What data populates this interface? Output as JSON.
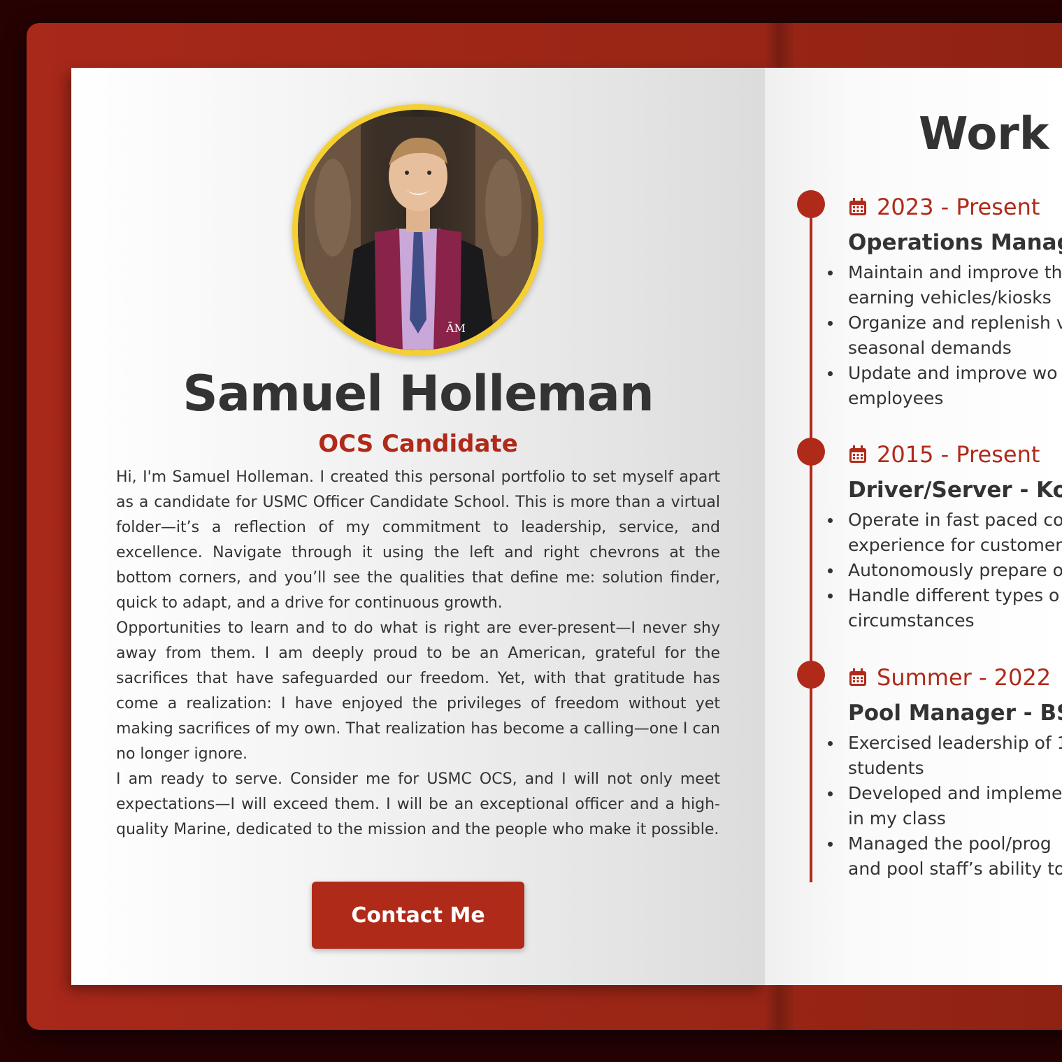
{
  "profile": {
    "name": "Samuel Holleman",
    "role": "OCS Candidate",
    "bio": [
      "Hi, I'm Samuel Holleman. I created this personal portfolio to set myself apart as a candidate for USMC Officer Candidate School. This is more than a virtual folder—it’s a reflection of my commitment to leadership, service, and excellence. Navigate through it using the left and right chevrons at the bottom corners, and you’ll see the qualities that define me: solution finder, quick to adapt, and a drive for continuous growth.",
      "Opportunities to learn and to do what is right are ever-present—I never shy away from them. I am deeply proud to be an American, grateful for the sacrifices that have safeguarded our freedom. Yet, with that gratitude has come a realization: I have enjoyed the privileges of freedom without yet making sacrifices of my own. That realization has become a calling—one I can no longer ignore.",
      "I am ready to serve. Consider me for USMC OCS, and I will not only meet expectations—I will exceed them. I will be an exceptional officer and a high-quality Marine, dedicated to the mission and the people who make it possible."
    ],
    "contact_label": "Contact Me"
  },
  "experience": {
    "title": "Work E",
    "entries": [
      {
        "date": "2023 - Present",
        "title": "Operations Manag",
        "duties": [
          "Maintain and improve th",
          "earning vehicles/kiosks",
          "Organize and replenish v",
          "seasonal demands",
          "Update and improve wo",
          "employees"
        ]
      },
      {
        "date": "2015 - Present",
        "title": "Driver/Server - Kor",
        "duties": [
          "Operate in fast paced co",
          "experience for customer",
          "Autonomously prepare o",
          "Handle different types o",
          "circumstances"
        ]
      },
      {
        "date": "Summer - 2022",
        "title": "Pool Manager - BSA",
        "duties": [
          "Exercised leadership of 1",
          "students",
          "Developed and impleme",
          "in my class",
          "Managed the pool/prog",
          "and pool staff’s ability to"
        ]
      }
    ]
  },
  "colors": {
    "accent": "#b02a1a",
    "ring": "#f5d033",
    "text": "#333333",
    "background": "#260203"
  },
  "icons": {
    "date": "calendar-icon"
  }
}
